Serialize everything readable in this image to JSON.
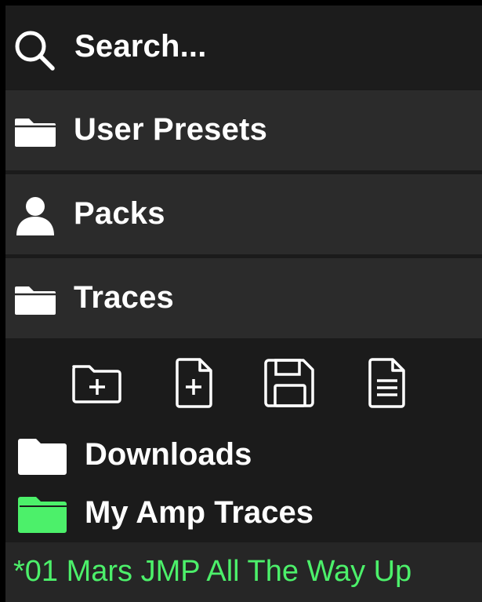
{
  "search": {
    "label": "Search...",
    "icon": "search-icon"
  },
  "nav": {
    "items": [
      {
        "label": "User Presets",
        "icon": "folder-icon"
      },
      {
        "label": "Packs",
        "icon": "person-icon"
      },
      {
        "label": "Traces",
        "icon": "folder-icon"
      }
    ]
  },
  "toolbar": {
    "buttons": [
      {
        "icon": "new-folder-icon"
      },
      {
        "icon": "new-file-icon"
      },
      {
        "icon": "save-icon"
      },
      {
        "icon": "document-icon"
      }
    ]
  },
  "tree": {
    "items": [
      {
        "label": "Downloads",
        "icon": "folder-icon",
        "color": "#ffffff"
      },
      {
        "label": "My Amp Traces",
        "icon": "folder-icon",
        "color": "#4cf06a"
      }
    ]
  },
  "selected_file": {
    "label": "*01 Mars JMP All The Way Up",
    "color": "#4cf06a"
  },
  "colors": {
    "accent": "#4cf06a",
    "panel": "#1b1b1b",
    "row": "#2b2b2b"
  }
}
